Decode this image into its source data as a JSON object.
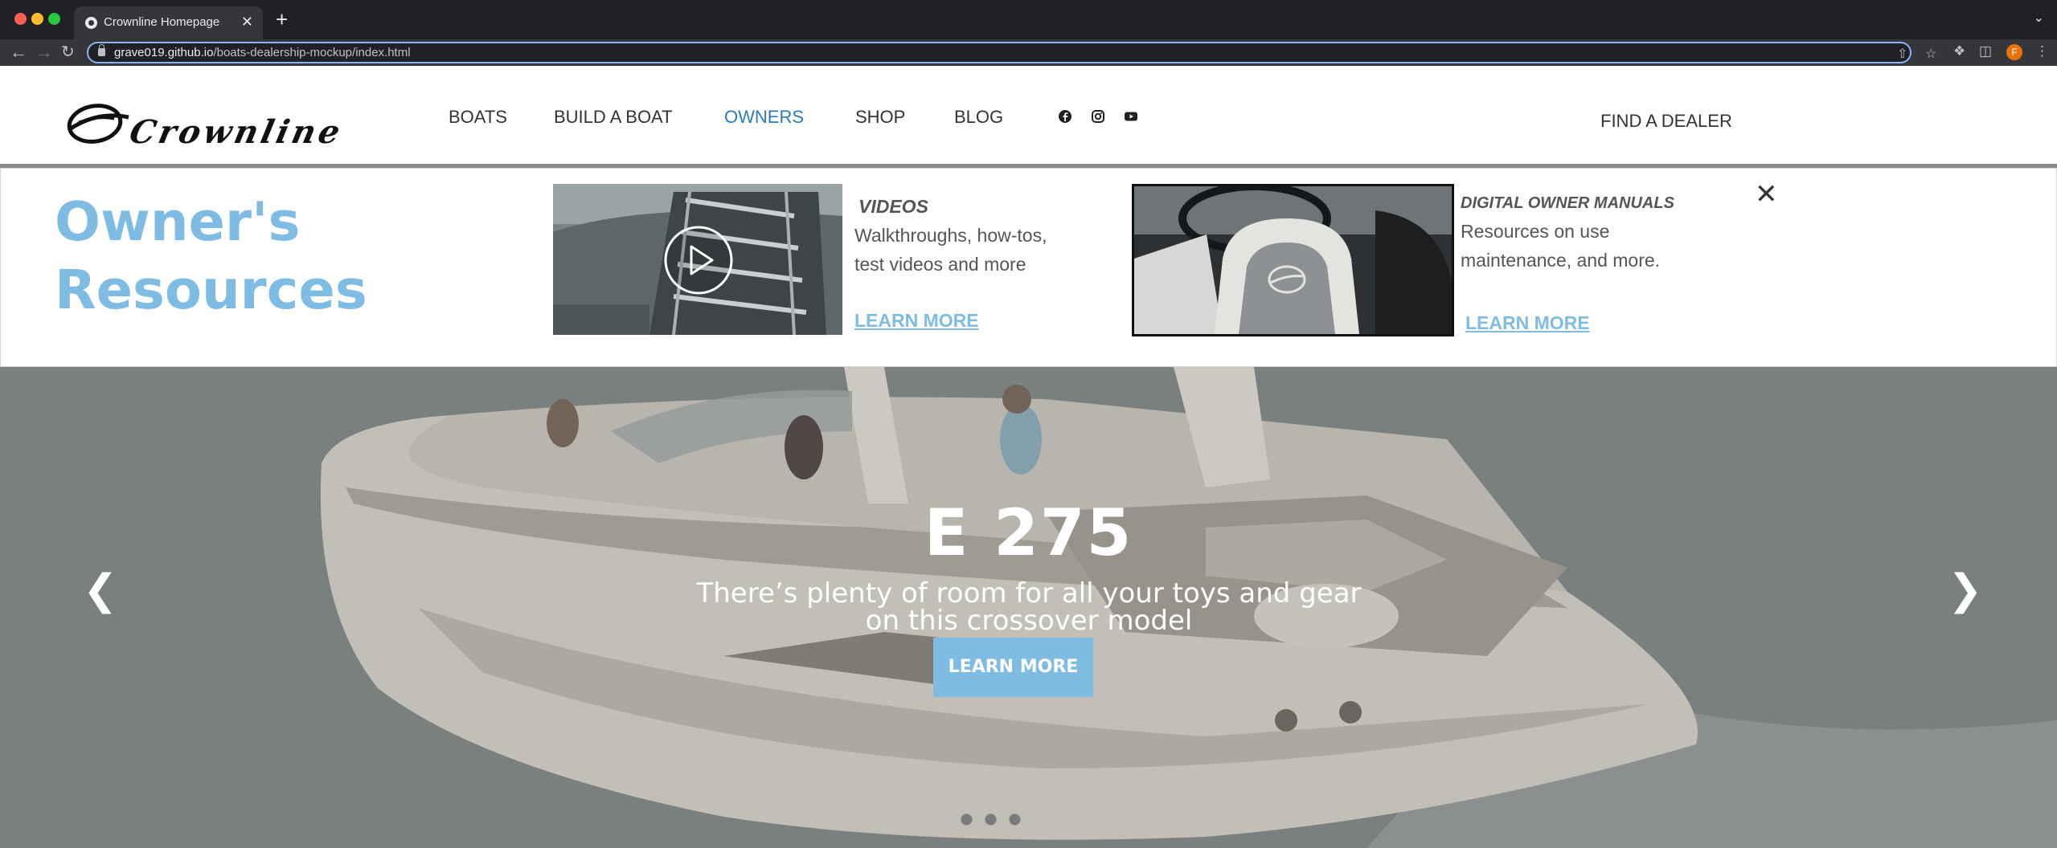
{
  "browser": {
    "tab_title": "Crownline Homepage",
    "tab_close": "✕",
    "new_tab": "+",
    "url_host": "grave019.github.io",
    "url_path": "/boats-dealership-mockup/index.html",
    "profile_initial": "F"
  },
  "header": {
    "logo_text": "Crownline",
    "nav": [
      "BOATS",
      "BUILD A BOAT",
      "OWNERS",
      "SHOP",
      "BLOG"
    ],
    "active_nav": "OWNERS",
    "active_color": "#2b7bbd",
    "social_icons": [
      "facebook-icon",
      "instagram-icon",
      "youtube-icon"
    ],
    "find_dealer": "FIND A DEALER"
  },
  "dropdown": {
    "title": "Owner's Resources",
    "accent_color": "#7fbce3",
    "videos": {
      "heading": "VIDEOS",
      "body": "Walkthroughs, how-tos, test videos and more",
      "link": "LEARN MORE"
    },
    "manuals": {
      "heading": "DIGITAL OWNER MANUALS",
      "body": "Resources on use maintenance, and more.",
      "link": "LEARN MORE"
    },
    "close": "✕"
  },
  "hero": {
    "title": "E 275",
    "subtitle": "There’s plenty of room for all your toys and gear on this crossover model",
    "button": "LEARN MORE",
    "prev": "❮",
    "next": "❯",
    "slide_count": 3,
    "active_slide": 1
  }
}
